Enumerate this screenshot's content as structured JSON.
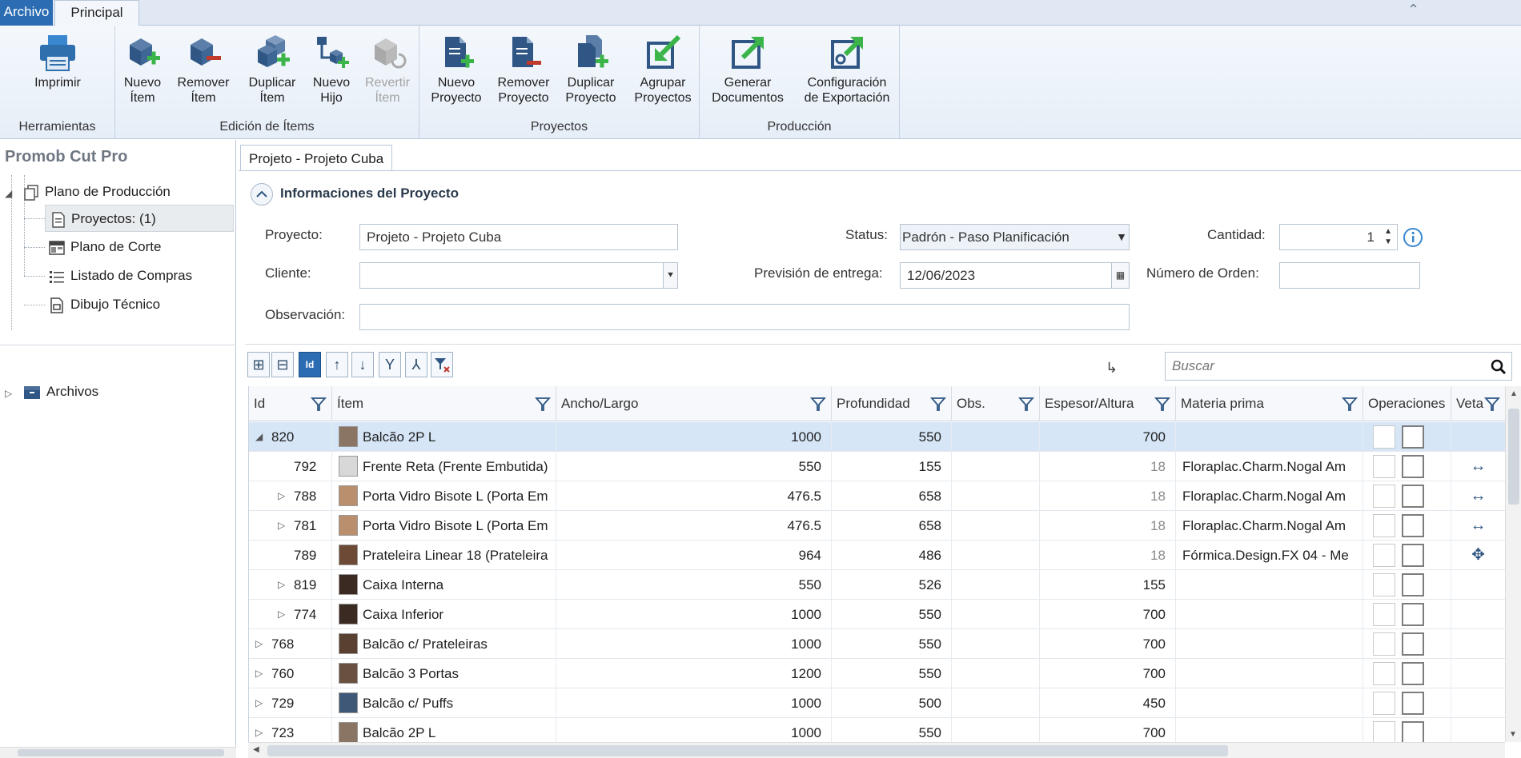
{
  "ribbon": {
    "tabs": {
      "file": "Archivo",
      "main": "Principal"
    },
    "groups": {
      "tools": "Herramientas",
      "item_editing": "Edición de Ítems",
      "projects": "Proyectos",
      "production": "Producción"
    },
    "buttons": {
      "print": [
        "Imprimir",
        ""
      ],
      "new_item": [
        "Nuevo",
        "Ítem"
      ],
      "remove_item": [
        "Remover",
        "Ítem"
      ],
      "duplicate_item": [
        "Duplicar",
        "Ítem"
      ],
      "new_child": [
        "Nuevo",
        "Hijo"
      ],
      "revert_item": [
        "Revertir",
        "Ítem"
      ],
      "new_project": [
        "Nuevo",
        "Proyecto"
      ],
      "remove_project": [
        "Remover",
        "Proyecto"
      ],
      "duplicate_project": [
        "Duplicar",
        "Proyecto"
      ],
      "group_projects": [
        "Agrupar",
        "Proyectos"
      ],
      "generate_docs": [
        "Generar",
        "Documentos"
      ],
      "export_config": [
        "Configuración",
        "de Exportación"
      ]
    }
  },
  "left": {
    "title": "Promob Cut Pro",
    "tree": {
      "production_plan": "Plano de Producción",
      "projects": "Proyectos: (1)",
      "cut_plan": "Plano de Corte",
      "purchase_list": "Listado de Compras",
      "technical_drawing": "Dibujo Técnico",
      "files": "Archivos"
    }
  },
  "doc": {
    "tab": "Projeto - Projeto Cuba",
    "section": "Informaciones del Proyecto",
    "form": {
      "project_label": "Proyecto:",
      "project_value": "Projeto - Projeto Cuba",
      "client_label": "Cliente:",
      "client_value": "",
      "observation_label": "Observación:",
      "observation_value": "",
      "status_label": "Status:",
      "status_value": "Padrón - Paso Planificación",
      "delivery_label": "Previsión de entrega:",
      "delivery_value": "12/06/2023",
      "quantity_label": "Cantidad:",
      "quantity_value": "1",
      "order_label": "Número de Orden:",
      "order_value": ""
    },
    "search_placeholder": "Buscar",
    "toolbar": {
      "id_toggle": "Id"
    }
  },
  "grid": {
    "columns": [
      "Id",
      "Ítem",
      "Ancho/Largo",
      "Profundidad",
      "Obs.",
      "Espesor/Altura",
      "Materia prima",
      "Operaciones",
      "Veta"
    ],
    "rows": [
      {
        "id": "820",
        "item": "Balcão 2P L",
        "width": "1000",
        "depth": "550",
        "obs": "",
        "thickness": "700",
        "material": "",
        "veta": ""
      },
      {
        "id": "792",
        "item": "Frente Reta (Frente Embutida)",
        "width": "550",
        "depth": "155",
        "obs": "",
        "thickness": "18",
        "material": "Floraplac.Charm.Nogal Am",
        "veta": "↔"
      },
      {
        "id": "788",
        "item": "Porta Vidro Bisote L (Porta Em",
        "width": "476.5",
        "depth": "658",
        "obs": "",
        "thickness": "18",
        "material": "Floraplac.Charm.Nogal Am",
        "veta": "↔"
      },
      {
        "id": "781",
        "item": "Porta Vidro Bisote L (Porta Em",
        "width": "476.5",
        "depth": "658",
        "obs": "",
        "thickness": "18",
        "material": "Floraplac.Charm.Nogal Am",
        "veta": "↔"
      },
      {
        "id": "789",
        "item": "Prateleira Linear 18 (Prateleira",
        "width": "964",
        "depth": "486",
        "obs": "",
        "thickness": "18",
        "material": "Fórmica.Design.FX 04 - Me",
        "veta": "✥"
      },
      {
        "id": "819",
        "item": "Caixa Interna",
        "width": "550",
        "depth": "526",
        "obs": "",
        "thickness": "155",
        "material": "",
        "veta": ""
      },
      {
        "id": "774",
        "item": "Caixa Inferior",
        "width": "1000",
        "depth": "550",
        "obs": "",
        "thickness": "700",
        "material": "",
        "veta": ""
      },
      {
        "id": "768",
        "item": "Balcão c/ Prateleiras",
        "width": "1000",
        "depth": "550",
        "obs": "",
        "thickness": "700",
        "material": "",
        "veta": ""
      },
      {
        "id": "760",
        "item": "Balcão 3 Portas",
        "width": "1200",
        "depth": "550",
        "obs": "",
        "thickness": "700",
        "material": "",
        "veta": ""
      },
      {
        "id": "729",
        "item": "Balcão c/ Puffs",
        "width": "1000",
        "depth": "500",
        "obs": "",
        "thickness": "450",
        "material": "",
        "veta": ""
      },
      {
        "id": "723",
        "item": "Balcão 2P L",
        "width": "1000",
        "depth": "550",
        "obs": "",
        "thickness": "700",
        "material": "",
        "veta": ""
      }
    ]
  },
  "colors": {
    "accent": "#2b6cb3",
    "selected_row": "#d6e6f7",
    "plus_green": "#3bb54a",
    "minus_red": "#c0392b"
  }
}
